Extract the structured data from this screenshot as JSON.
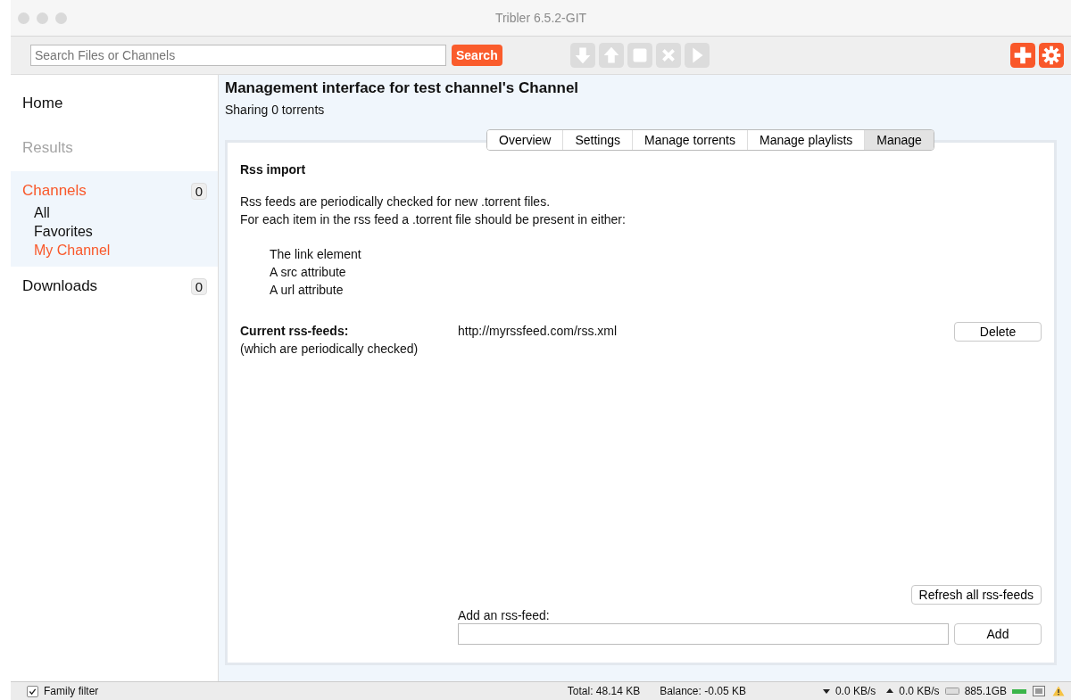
{
  "window": {
    "title": "Tribler 6.5.2-GIT"
  },
  "toolbar": {
    "search": {
      "placeholder": "Search Files or Channels"
    },
    "search_button": "Search",
    "actions": [
      {
        "kind": "down",
        "disabled": true
      },
      {
        "kind": "up",
        "disabled": true
      },
      {
        "kind": "stop",
        "disabled": true
      },
      {
        "kind": "delete",
        "disabled": true
      },
      {
        "kind": "play",
        "disabled": true
      }
    ],
    "right_actions": [
      {
        "kind": "add",
        "disabled": false
      },
      {
        "kind": "settings",
        "disabled": false
      }
    ]
  },
  "sidebar": {
    "items": [
      {
        "label": "Home",
        "selected": false,
        "disabled": false
      },
      {
        "label": "Results",
        "selected": false,
        "disabled": true
      },
      {
        "label": "Channels",
        "selected": true,
        "disabled": false,
        "count": "0",
        "children": [
          {
            "label": "All",
            "selected": false
          },
          {
            "label": "Favorites",
            "selected": false
          },
          {
            "label": "My Channel",
            "selected": true
          }
        ]
      },
      {
        "label": "Downloads",
        "selected": false,
        "disabled": false,
        "count": "0"
      }
    ]
  },
  "header": {
    "title": "Management interface for test channel's Channel",
    "subtitle": "Sharing 0 torrents"
  },
  "tabs": [
    {
      "label": "Overview",
      "selected": false
    },
    {
      "label": "Settings",
      "selected": false
    },
    {
      "label": "Manage torrents",
      "selected": false
    },
    {
      "label": "Manage playlists",
      "selected": false
    },
    {
      "label": "Manage",
      "selected": true
    }
  ],
  "panel": {
    "heading": "Rss import",
    "intro": [
      "Rss feeds are periodically checked for new .torrent files.",
      "For each item in the rss feed a .torrent file should be present in either:"
    ],
    "options": [
      "The link element",
      "A src attribute",
      "A url attribute"
    ],
    "feeds_label": "Current rss-feeds:",
    "feeds_note": "(which are periodically checked)",
    "feeds": [
      {
        "url": "http://myrssfeed.com/rss.xml",
        "button": "Delete"
      }
    ],
    "refresh_button": "Refresh all rss-feeds",
    "add_label": "Add an rss-feed:",
    "add_button": "Add"
  },
  "status_bar": {
    "family_filter": {
      "label": "Family filter",
      "checked": true
    },
    "total": "Total: 48.14 KB",
    "balance": "Balance: -0.05 KB",
    "down": "0.0 KB/s",
    "up": "0.0 KB/s",
    "disk": "885.1GB"
  }
}
